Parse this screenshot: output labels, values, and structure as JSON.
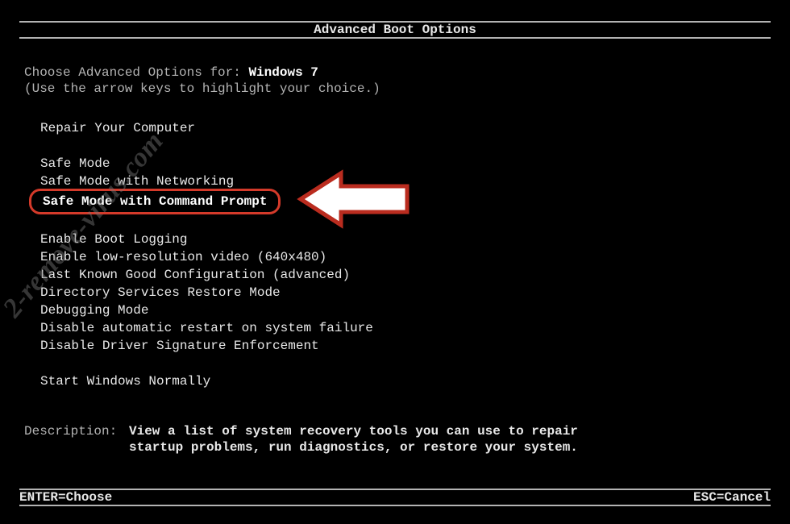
{
  "title": "Advanced Boot Options",
  "intro": {
    "prefix": "Choose Advanced Options for: ",
    "os": "Windows 7",
    "hint": "(Use the arrow keys to highlight your choice.)"
  },
  "menu": {
    "groups": [
      [
        "Repair Your Computer"
      ],
      [
        "Safe Mode",
        "Safe Mode with Networking",
        "Safe Mode with Command Prompt"
      ],
      [
        "Enable Boot Logging",
        "Enable low-resolution video (640x480)",
        "Last Known Good Configuration (advanced)",
        "Directory Services Restore Mode",
        "Debugging Mode",
        "Disable automatic restart on system failure",
        "Disable Driver Signature Enforcement"
      ],
      [
        "Start Windows Normally"
      ]
    ],
    "highlighted": "Safe Mode with Command Prompt"
  },
  "description": {
    "label": "Description:",
    "text": "View a list of system recovery tools you can use to repair startup problems, run diagnostics, or restore your system."
  },
  "footer": {
    "left": "ENTER=Choose",
    "right": "ESC=Cancel"
  },
  "watermark": "2-remove-virus.com",
  "annotation": {
    "arrow_stroke": "#ba2c1f",
    "arrow_fill": "#ffffff"
  }
}
